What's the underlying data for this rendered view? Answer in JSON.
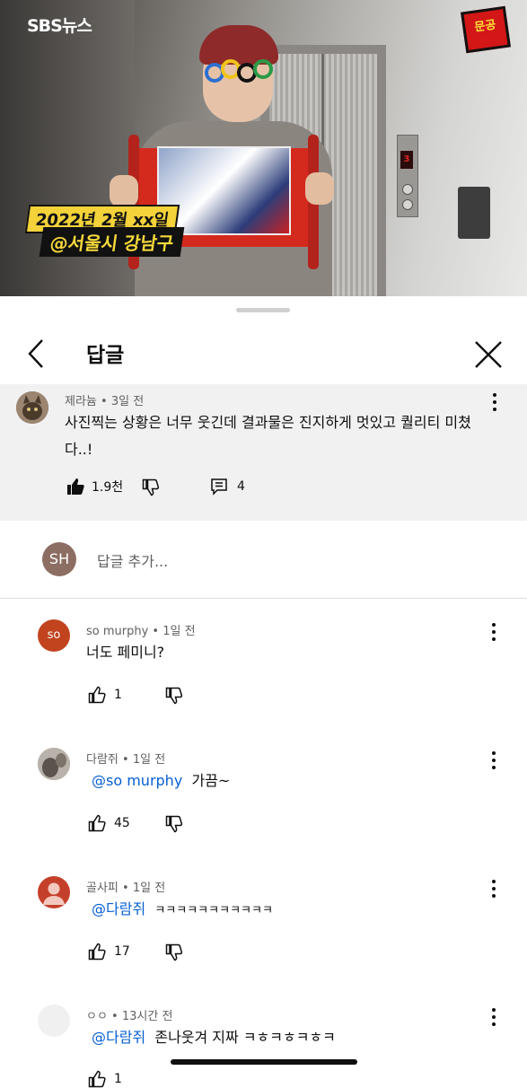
{
  "video": {
    "logo_text": "SBS뉴스",
    "badge_text": "문공",
    "caption_date": "2022년 2월 xx일",
    "caption_place": "@서울시 강남구",
    "elevator_floor": "3"
  },
  "header": {
    "title": "답글"
  },
  "parent_comment": {
    "author": "제라늄",
    "time": "3일 전",
    "text": "사진찍는 상황은 너무 웃긴데 결과물은 진지하게 멋있고 퀄리티 미쳤다..!",
    "likes": "1.9천",
    "reply_count": "4"
  },
  "add_reply": {
    "avatar_initials": "SH",
    "placeholder": "답글 추가..."
  },
  "replies": [
    {
      "author": "so murphy",
      "time": "1일 전",
      "mention": "",
      "text": "너도 페미니?",
      "likes": "1",
      "avatar_letters": "so",
      "avatar_color": "#c1441f"
    },
    {
      "author": "다람쥐",
      "time": "1일 전",
      "mention": "@so murphy",
      "text": "가끔~",
      "likes": "45",
      "avatar_color": "#8a8178"
    },
    {
      "author": "골사피",
      "time": "1일 전",
      "mention": "@다람쥐",
      "text": "ㅋㅋㅋㅋㅋㅋㅋㅋㅋㅋㅋ",
      "likes": "17",
      "avatar_color": "#c5402a"
    },
    {
      "author": "ㅇㅇ",
      "time": "13시간 전",
      "mention": "@다람쥐",
      "text": "존나웃겨 지짜 ㅋㅎㅋㅎㅋㅎㅋ",
      "likes": "1",
      "avatar_color": "#f0f0f0"
    }
  ],
  "colors": {
    "link": "#065fd4",
    "meta": "#606060",
    "parent_bg": "#f1f1f1"
  }
}
